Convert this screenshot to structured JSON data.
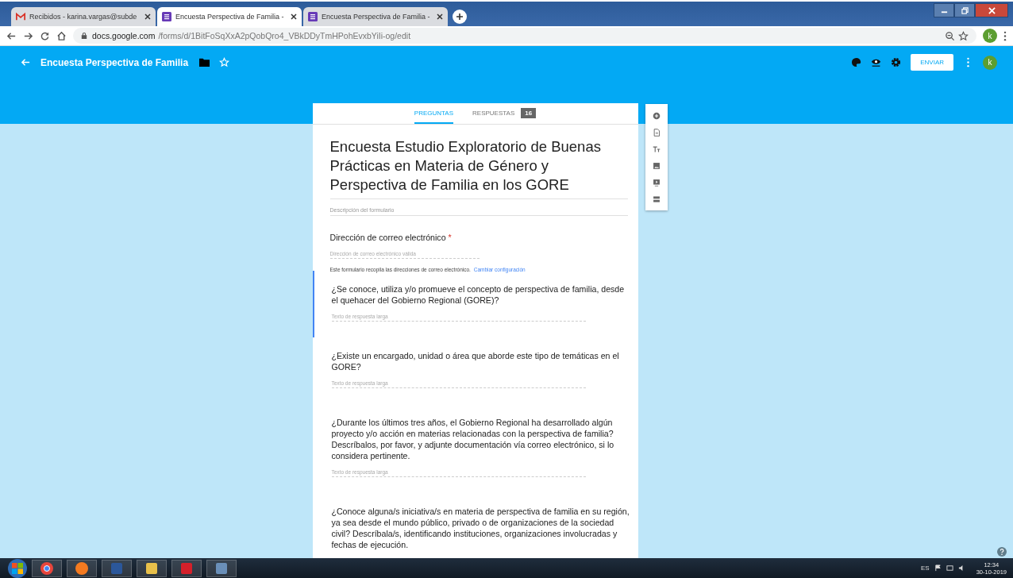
{
  "browser": {
    "tabs": [
      {
        "title": "Recibidos - karina.vargas@subde",
        "kind": "gmail",
        "selected": false
      },
      {
        "title": "Encuesta Perspectiva de Familia -",
        "kind": "forms",
        "selected": true
      },
      {
        "title": "Encuesta Perspectiva de Familia -",
        "kind": "forms",
        "selected": false
      }
    ],
    "url_host": "docs.google.com",
    "url_path": "/forms/d/1BitFoSqXxA2pQobQro4_VBkDDyTmHPohEvxbYiIi-og/edit",
    "avatar": "k"
  },
  "header": {
    "title": "Encuesta Perspectiva de Familia",
    "send_button": "ENVIAR",
    "avatar": "k"
  },
  "form_tabs": [
    {
      "label": "PREGUNTAS",
      "selected": true
    },
    {
      "label": "RESPUESTAS",
      "selected": false,
      "badge": "16"
    }
  ],
  "form": {
    "title": "Encuesta Estudio Exploratorio de Buenas Prácticas en Materia de Género y Perspectiva de Familia en los GORE",
    "description_placeholder": "Descripción del formulario",
    "email": {
      "label": "Dirección de correo electrónico",
      "required_mark": "*",
      "placeholder": "Dirección de correo electrónico válida",
      "note": "Este formulario recopila las direcciones de correo electrónico.",
      "link": "Cambiar configuración"
    },
    "questions": [
      {
        "text": "¿Se conoce, utiliza y/o promueve el concepto de perspectiva de familia, desde el quehacer del Gobierno Regional (GORE)?",
        "placeholder": "Texto de respuesta larga",
        "selected": true
      },
      {
        "text": "¿Existe un encargado, unidad o área que aborde este tipo de temáticas en el GORE?",
        "placeholder": "Texto de respuesta larga",
        "selected": false
      },
      {
        "text": "¿Durante los últimos tres años, el Gobierno Regional ha desarrollado algún proyecto y/o acción en materias relacionadas con la perspectiva de familia? Descríbalos, por favor, y adjunte documentación vía correo electrónico, si lo considera pertinente.",
        "placeholder": "Texto de respuesta larga",
        "selected": false
      },
      {
        "text": "¿Conoce alguna/s iniciativa/s en materia de perspectiva de familia en su región, ya sea desde el mundo público, privado o de organizaciones de la sociedad civil? Descríbala/s, identificando instituciones, organizaciones involucradas y fechas de ejecución.",
        "selected": false
      }
    ]
  },
  "taskbar": {
    "apps": [
      {
        "kind": "chrome"
      },
      {
        "kind": "firefox"
      },
      {
        "kind": "word"
      },
      {
        "kind": "folder"
      },
      {
        "kind": "pdf"
      },
      {
        "kind": "paint"
      }
    ],
    "language": "ES",
    "time": "12:34",
    "date": "30-10-2019"
  }
}
